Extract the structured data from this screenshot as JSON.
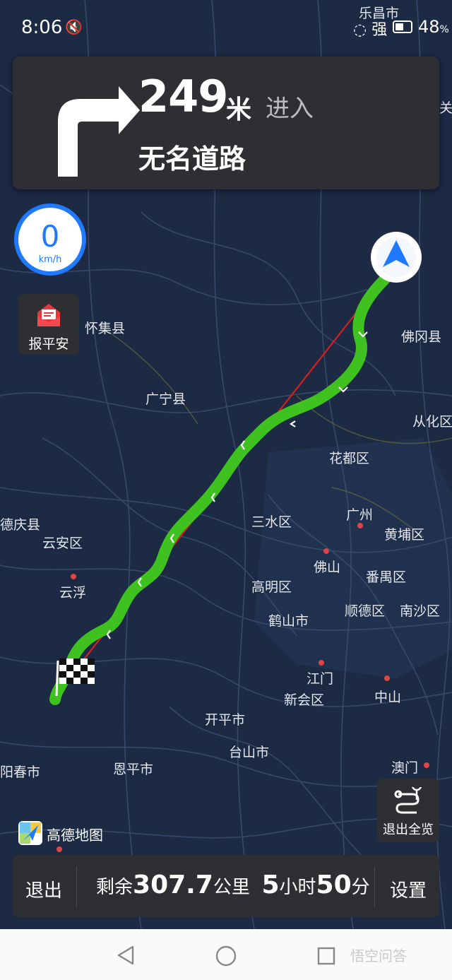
{
  "status_bar": {
    "time": "8:06",
    "mute_icon": "speaker-mute-icon",
    "signal": "强",
    "battery": "48",
    "battery_pct_sign": "%"
  },
  "guidance": {
    "distance": "249",
    "unit": "米",
    "action": "进入",
    "road": "无名道路",
    "turn_icon": "turn-right-arrow-icon"
  },
  "speed": {
    "value": "0",
    "unit": "km/h"
  },
  "safety": {
    "label": "报平安",
    "icon": "envelope-icon"
  },
  "overview": {
    "label": "退出全览",
    "icon": "route-overview-icon"
  },
  "logo": {
    "text": "高德地图"
  },
  "bottom_bar": {
    "exit": "退出",
    "remain_prefix": "剩余",
    "remain_distance": "307.7",
    "remain_unit": "公里",
    "hours": "5",
    "hours_unit": "小时",
    "minutes": "50",
    "minutes_unit": "分",
    "settings": "设置"
  },
  "map": {
    "places": [
      {
        "name": "乐昌市"
      },
      {
        "name": "关"
      },
      {
        "name": "怀集县"
      },
      {
        "name": "佛冈县"
      },
      {
        "name": "广宁县"
      },
      {
        "name": "从化区"
      },
      {
        "name": "花都区"
      },
      {
        "name": "广州"
      },
      {
        "name": "三水区"
      },
      {
        "name": "黄埔区"
      },
      {
        "name": "德庆县"
      },
      {
        "name": "云安区"
      },
      {
        "name": "佛山"
      },
      {
        "name": "番禺区"
      },
      {
        "name": "云浮"
      },
      {
        "name": "高明区"
      },
      {
        "name": "顺德区"
      },
      {
        "name": "南沙区"
      },
      {
        "name": "鹤山市"
      },
      {
        "name": "江门"
      },
      {
        "name": "新会区"
      },
      {
        "name": "中山"
      },
      {
        "name": "开平市"
      },
      {
        "name": "台山市"
      },
      {
        "name": "阳春市"
      },
      {
        "name": "恩平市"
      },
      {
        "name": "澳门"
      }
    ],
    "colors": {
      "route": "#3fc21f",
      "straight_line": "#d42020",
      "background": "#1c2a44"
    }
  },
  "system_nav": {
    "back_icon": "back-triangle-icon",
    "home_icon": "home-circle-icon",
    "recents_icon": "recents-square-icon",
    "watermark": "悟空问答"
  }
}
